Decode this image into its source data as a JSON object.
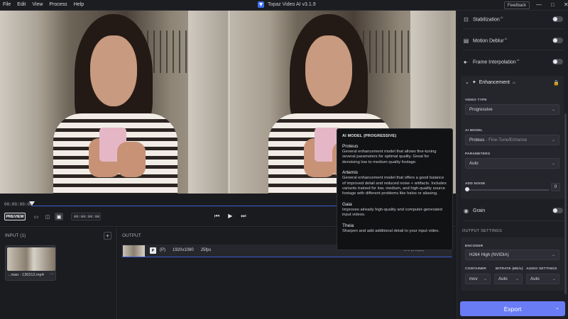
{
  "titlebar": {
    "menu": [
      "File",
      "Edit",
      "View",
      "Process",
      "Help"
    ],
    "app_title": "Topaz Video AI  v3.1.9",
    "feedback_label": "Feedback",
    "controls": [
      "—",
      "□",
      "✕"
    ]
  },
  "timeline": {
    "start_timecode": "00:00:00:00",
    "preview_label": "PREVIEW",
    "current_timecode": "00:00:00:00"
  },
  "input": {
    "header": "INPUT (1)",
    "add_label": "+",
    "clip_name": "...man - 130212.mp4",
    "more_label": "···"
  },
  "output": {
    "header": "OUTPUT",
    "badge": "P",
    "mode": "(P)",
    "resolution": "1920x1080",
    "fps": "25fps",
    "right_text": "3%  (0.9fps)",
    "more_label": "···"
  },
  "tooltip": {
    "title": "AI MODEL (PROGRESSIVE)",
    "items": [
      {
        "name": "Proteus",
        "desc": "General enhancement model that allows fine-tuning several parameters for optimal quality. Great for denoising low to medium quality footage."
      },
      {
        "name": "Artemis",
        "desc": "General enhancement model that offers a good balance of improved detail and reduced noise + artifacts. Includes variants trained for low, medium, and high-quality source footage with different problems like halos or aliasing."
      },
      {
        "name": "Gaia",
        "desc": "Improves already high-quality and computer-generated input videos."
      },
      {
        "name": "Theia",
        "desc": "Sharpen and add additional detail to your input video."
      }
    ]
  },
  "sidebar": {
    "stabilization": "Stabilization",
    "motion_deblur": "Motion Deblur",
    "frame_interpolation": "Frame Interpolation",
    "ai_sup": "AI",
    "enhancement": "Enhancement",
    "video_type_label": "VIDEO TYPE",
    "video_type_value": "Progressive",
    "ai_model_label": "AI MODEL",
    "ai_model_value": "Proteus",
    "ai_model_variant": "- Fine-Tune/Enhance",
    "parameters_label": "PARAMETERS",
    "parameters_value": "Auto",
    "add_noise_label": "ADD NOISE",
    "add_noise_value": "0",
    "grain": "Grain",
    "output_settings": "OUTPUT SETTINGS",
    "encoder_label": "ENCODER",
    "encoder_value": "H264 High (NVIDIA)",
    "container_label": "CONTAINER",
    "container_value": "mov",
    "bitrate_label": "BITRATE (Mb/s)",
    "bitrate_value": "Auto",
    "audio_label": "AUDIO SETTINGS",
    "audio_value": "Auto",
    "export_label": "Export"
  },
  "colors": {
    "accent": "#6a7cf5",
    "track": "#3b5bd6",
    "background": "#16171b"
  }
}
